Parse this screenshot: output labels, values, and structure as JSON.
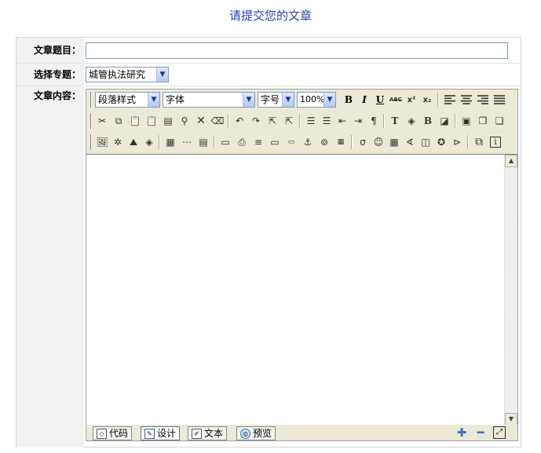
{
  "page": {
    "title": "请提交您的文章"
  },
  "form": {
    "article_title_label": "文章题目：",
    "article_title_value": "",
    "topic_label": "选择专题：",
    "topic_selected": "城管执法研究",
    "content_label": "文章内容："
  },
  "toolbar": {
    "paragraph_style": "段落样式",
    "font": "字体",
    "font_size": "字号",
    "zoom": "100%",
    "bold": "B",
    "italic": "I",
    "underline": "U",
    "strike": "ABC",
    "superscript": "x²",
    "subscript": "x₂"
  },
  "modes": {
    "code": "代码",
    "design": "设计",
    "text": "文本",
    "preview": "预览"
  },
  "icons": {
    "row1": [
      "align-left-icon",
      "align-center-icon",
      "align-right-icon",
      "align-justify-icon"
    ],
    "row2": [
      "cut-icon",
      "copy-icon",
      "paste-icon",
      "paste-text-icon",
      "paste-word-icon",
      "find-icon",
      "delete-icon",
      "eraser-icon",
      "undo-icon",
      "redo-icon",
      "select-icon",
      "select-all-icon",
      "ordered-list-icon",
      "unordered-list-icon",
      "outdent-icon",
      "indent-icon",
      "paragraph-icon",
      "font-color-icon",
      "highlight-icon",
      "back-color-icon",
      "remove-format-icon",
      "show-borders-icon",
      "absolute-position-icon",
      "bring-forward-icon"
    ],
    "row3": [
      "insert-image-icon",
      "insert-flash-icon",
      "insert-media-icon",
      "insert-file-icon",
      "insert-table-icon",
      "insert-row-icon",
      "table-props-icon",
      "insert-date-icon",
      "insert-template-icon",
      "insert-hr-icon",
      "insert-input-icon",
      "insert-marquee-icon",
      "anchor-icon",
      "hyperlink-icon",
      "insert-web-icon",
      "insert-symbol-icon",
      "insert-emoticon-icon",
      "excel-icon",
      "word-icon",
      "powerpoint-icon",
      "insert-formula-icon",
      "page-break-icon",
      "fullscreen-icon",
      "info-icon"
    ]
  }
}
